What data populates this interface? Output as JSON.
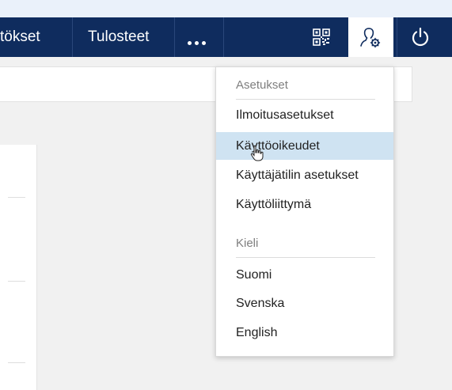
{
  "navbar": {
    "items": [
      {
        "label": "tökset"
      },
      {
        "label": "Tulosteet"
      }
    ],
    "more_icon": "more-dots-icon",
    "qr_icon": "qr-code-icon",
    "user_settings_icon": "user-gear-icon",
    "power_icon": "power-icon",
    "colors": {
      "background": "#0f2c5e",
      "active_tab": "#ffffff"
    }
  },
  "dropdown": {
    "settings_header": "Asetukset",
    "settings_items": [
      {
        "label": "Ilmoitusasetukset"
      },
      {
        "label": "Käyttöoikeudet"
      },
      {
        "label": "Käyttäjätilin asetukset"
      },
      {
        "label": "Käyttöliittymä"
      }
    ],
    "language_header": "Kieli",
    "language_items": [
      {
        "label": "Suomi"
      },
      {
        "label": "Svenska"
      },
      {
        "label": "English"
      }
    ],
    "hover_color": "#cfe3f2"
  }
}
